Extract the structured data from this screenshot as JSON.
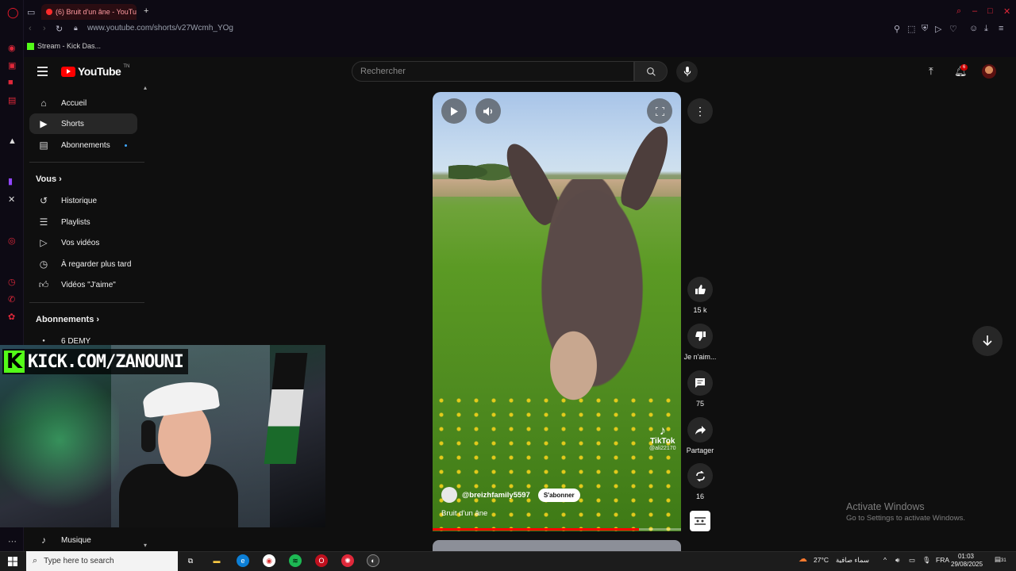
{
  "browser": {
    "tab_title": "(6) Bruit d'un âne - YouTu",
    "url": "www.youtube.com/shorts/v27Wcmh_YOg",
    "bookmark": "Stream - Kick Das..."
  },
  "header": {
    "logo_text": "YouTube",
    "logo_suffix": "TN",
    "search_placeholder": "Rechercher",
    "notification_count": "6"
  },
  "sidebar": {
    "main": [
      {
        "label": "Accueil",
        "icon": "home-icon"
      },
      {
        "label": "Shorts",
        "icon": "shorts-icon"
      },
      {
        "label": "Abonnements",
        "icon": "subscriptions-icon"
      }
    ],
    "you_heading": "Vous",
    "you_items": [
      {
        "label": "Historique",
        "icon": "history-icon"
      },
      {
        "label": "Playlists",
        "icon": "playlists-icon"
      },
      {
        "label": "Vos vidéos",
        "icon": "your-videos-icon"
      },
      {
        "label": "À regarder plus tard",
        "icon": "watch-later-icon"
      },
      {
        "label": "Vidéos \"J'aime\"",
        "icon": "liked-videos-icon"
      }
    ],
    "subs_heading": "Abonnements",
    "subs_items": [
      {
        "label": "6 DEMY"
      }
    ],
    "bottom_item": {
      "label": "Musique",
      "icon": "music-icon"
    }
  },
  "overlay": {
    "banner_letter": "K",
    "banner_text": "KICK.COM/ZANOUNI"
  },
  "short": {
    "channel": "@breizhfamily5597",
    "subscribe_label": "S'abonner",
    "title": "Bruit d'un âne",
    "watermark_brand": "TikTok",
    "watermark_handle": "@ali22170",
    "progress": 0.83
  },
  "actions": {
    "likes": "15 k",
    "dislike_label": "Je n'aim...",
    "comments": "75",
    "share_label": "Partager",
    "remix_count": "16"
  },
  "activation": {
    "line1": "Activate Windows",
    "line2": "Go to Settings to activate Windows."
  },
  "taskbar": {
    "search_placeholder": "Type here to search",
    "weather": "27°C",
    "weather_desc": "سماء صافية",
    "language": "FRA",
    "time": "01:03",
    "date": "29/08/2025",
    "notif_count": "31"
  }
}
